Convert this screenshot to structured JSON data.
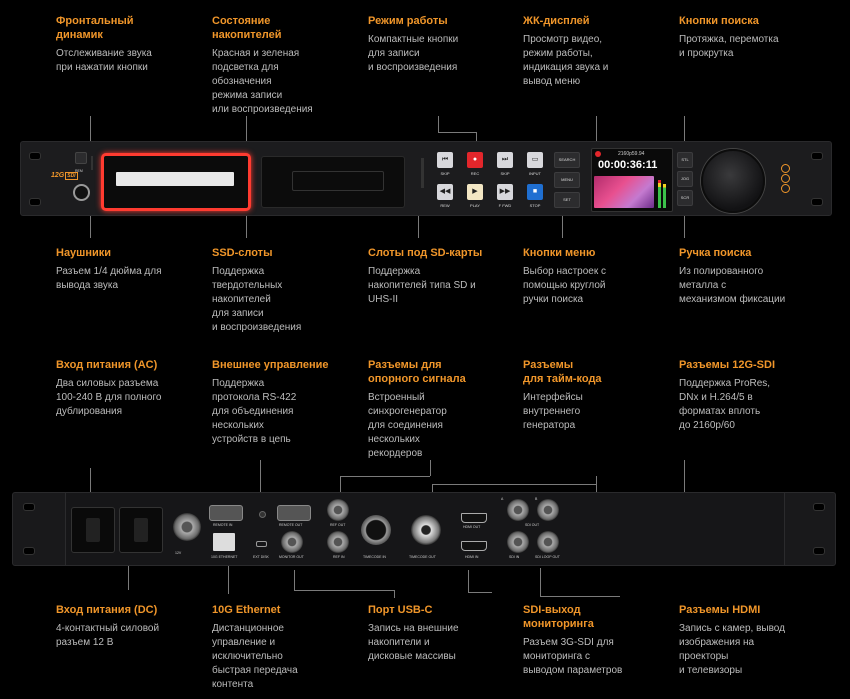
{
  "captions_top": [
    {
      "title": "Фронтальный\nдинамик",
      "desc": "Отслеживание звука\nпри нажатии кнопки"
    },
    {
      "title": "Состояние\nнакопителей",
      "desc": "Красная и зеленая\nподсветка для\nобозначения\nрежима записи\nили воспроизведения"
    },
    {
      "title": "Режим работы",
      "desc": "Компактные кнопки\nдля записи\nи воспроизведения"
    },
    {
      "title": "ЖК-дисплей",
      "desc": "Просмотр видео,\nрежим работы,\nиндикация звука и\nвывод меню"
    },
    {
      "title": "Кнопки поиска",
      "desc": "Протяжка, перемотка\nи прокрутка"
    }
  ],
  "captions_front_bottom": [
    {
      "title": "Наушники",
      "desc": "Разъем 1/4 дюйма для\nвывода звука"
    },
    {
      "title": "SSD-слоты",
      "desc": "Поддержка\nтвердотельных\nнакопителей\nдля записи\nи воспроизведения"
    },
    {
      "title": "Слоты под SD-карты",
      "desc": "Поддержка\nнакопителей типа SD и\nUHS-II"
    },
    {
      "title": "Кнопки меню",
      "desc": "Выбор настроек с\nпомощью круглой\nручки поиска"
    },
    {
      "title": "Ручка поиска",
      "desc": "Из полированного\nметалла с\nмеханизмом фиксации"
    }
  ],
  "captions_rear_top": [
    {
      "title": "Вход питания (AC)",
      "desc": "Два силовых разъема\n100-240 В для полного\nдублирования"
    },
    {
      "title": "Внешнее управление",
      "desc": "Поддержка\nпротокола RS-422\nдля объединения\nнескольких\nустройств в цепь"
    },
    {
      "title": "Разъемы для\nопорного сигнала",
      "desc": "Встроенный\nсинхрогенератор\nдля соединения\nнескольких\nрекордеров"
    },
    {
      "title": "Разъемы\nдля тайм-кода",
      "desc": "Интерфейсы\nвнутреннего\nгенератора"
    },
    {
      "title": "Разъемы 12G-SDI",
      "desc": "Поддержка ProRes,\nDNx и H.264/5 в\nформатах вплоть\nдо 2160p/60"
    }
  ],
  "captions_rear_bottom": [
    {
      "title": "Вход питания (DC)",
      "desc": "4-контактный силовой\nразъем 12 В"
    },
    {
      "title": "10G Ethernet",
      "desc": "Дистанционное\nуправление и\nисключительно\nбыстрая передача\nконтента"
    },
    {
      "title": "Порт USB-C",
      "desc": "Запись на внешние\nнакопители и\nдисковые массивы"
    },
    {
      "title": "SDI-выход\nмониторинга",
      "desc": "Разъем 3G-SDI для\nмониторинга с\nвыводом параметров"
    },
    {
      "title": "Разъемы HDMI",
      "desc": "Запись с камер, вывод\nизображения на\nпроекторы\nи телевизоры"
    }
  ],
  "front_panel": {
    "badge": "12G",
    "badge_sub": "SDI",
    "rem_label": "REM",
    "timecode": "00:00:36:11",
    "format": "2160p59.94",
    "buttons": [
      "SKIP",
      "REC",
      "SKIP",
      "INPUT",
      "REW",
      "PLAY",
      "F FWD",
      "STOP"
    ],
    "menu_buttons": [
      "SEARCH",
      "MENU",
      "SET"
    ],
    "search_buttons": [
      "STL",
      "JOG",
      "SCR"
    ]
  },
  "rear_panel": {
    "labels": [
      "REMOTE IN",
      "REMOTE OUT",
      "REF OUT",
      "TIMECODE IN",
      "TIMECODE OUT",
      "HDMI OUT",
      "SDI OUT",
      "10G ETHERNET",
      "EXT DISK",
      "MONITOR OUT",
      "REF IN",
      "HDMI IN",
      "SDI IN",
      "SDI LOOP OUT",
      "12V",
      "A",
      "B"
    ]
  },
  "colors": {
    "accent": "#f0962a",
    "rec_red": "#e3262b",
    "ssd_glow": "#ff3b30",
    "stop_blue": "#1f6fd1"
  }
}
